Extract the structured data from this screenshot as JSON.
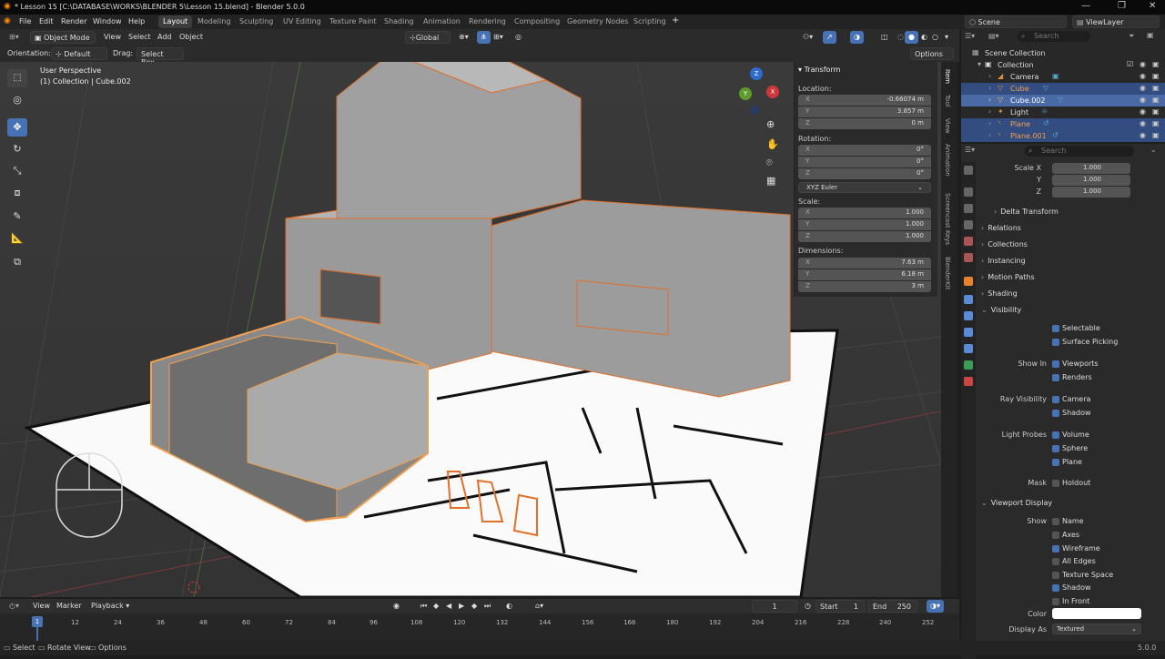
{
  "titlebar": {
    "title": "* Lesson 15 [C:\\DATABASE\\WORKS\\BLENDER 5\\Lesson 15.blend] - Blender 5.0.0"
  },
  "menu": {
    "file": "File",
    "edit": "Edit",
    "render": "Render",
    "window": "Window",
    "help": "Help"
  },
  "workspaces": [
    "Layout",
    "Modeling",
    "Sculpting",
    "UV Editing",
    "Texture Paint",
    "Shading",
    "Animation",
    "Rendering",
    "Compositing",
    "Geometry Nodes",
    "Scripting"
  ],
  "topright": {
    "scene": "Scene",
    "viewlayer": "ViewLayer"
  },
  "vptool": {
    "mode": "Object Mode",
    "view": "View",
    "select": "Select",
    "add": "Add",
    "object": "Object",
    "transform": "Global"
  },
  "vphdr2": {
    "orientation_label": "Orientation:",
    "orientation": "Default",
    "drag_label": "Drag:",
    "drag": "Select Box",
    "options": "Options"
  },
  "viewport": {
    "perspective": "User Perspective",
    "collection": "(1) Collection | Cube.002"
  },
  "npanel": {
    "title": "Transform",
    "location_label": "Location:",
    "loc_x": "-0.66074 m",
    "loc_y": "3.857 m",
    "loc_z": "0 m",
    "rotation_label": "Rotation:",
    "rot_x": "0°",
    "rot_y": "0°",
    "rot_z": "0°",
    "euler": "XYZ Euler",
    "scale_label": "Scale:",
    "scale_x": "1.000",
    "scale_y": "1.000",
    "scale_z": "1.000",
    "dimensions_label": "Dimensions:",
    "dim_x": "7.63 m",
    "dim_y": "6.18 m",
    "dim_z": "3 m",
    "x": "X",
    "y": "Y",
    "z": "Z"
  },
  "ntabs": [
    "Item",
    "Tool",
    "View",
    "Animation",
    "Screencast Keys",
    "BlenderKit"
  ],
  "outliner": {
    "search_placeholder": "Search",
    "scene_collection": "Scene Collection",
    "collection": "Collection",
    "items": [
      "Camera",
      "Cube",
      "Cube.002",
      "Light",
      "Plane",
      "Plane.001"
    ]
  },
  "props": {
    "search_placeholder": "Search",
    "scale_x_label": "Scale X",
    "scale_y_label": "Y",
    "scale_z_label": "Z",
    "scale_x": "1.000",
    "scale_y": "1.000",
    "scale_z": "1.000",
    "delta": "Delta Transform",
    "relations": "Relations",
    "collections": "Collections",
    "instancing": "Instancing",
    "motion_paths": "Motion Paths",
    "shading": "Shading",
    "visibility": "Visibility",
    "selectable": "Selectable",
    "surface_picking": "Surface Picking",
    "show_in": "Show In",
    "viewports": "Viewports",
    "renders": "Renders",
    "ray_visibility": "Ray Visibility",
    "camera": "Camera",
    "shadow": "Shadow",
    "light_probes": "Light Probes",
    "volume": "Volume",
    "sphere": "Sphere",
    "plane": "Plane",
    "mask": "Mask",
    "holdout": "Holdout",
    "viewport_display": "Viewport Display",
    "show": "Show",
    "name": "Name",
    "axes": "Axes",
    "wireframe": "Wireframe",
    "all_edges": "All Edges",
    "texture_space": "Texture Space",
    "shadow2": "Shadow",
    "in_front": "In Front",
    "color": "Color",
    "display_as_label": "Display As",
    "display_as": "Textured"
  },
  "timeline": {
    "view": "View",
    "marker": "Marker",
    "playback": "Playback",
    "current_frame": "1",
    "start_label": "Start",
    "start": "1",
    "end_label": "End",
    "end": "250",
    "ticks": [
      "12",
      "24",
      "36",
      "48",
      "60",
      "72",
      "84",
      "96",
      "108",
      "120",
      "132",
      "144",
      "156",
      "168",
      "180",
      "192",
      "204",
      "216",
      "228",
      "240",
      "252"
    ],
    "cursor": "1"
  },
  "statusbar": {
    "select": "Select",
    "rotate": "Rotate View",
    "options": "Options",
    "version": "5.0.0"
  },
  "colors": {
    "accent": "#4772b3",
    "selected_orange": "#f0a050",
    "bg": "#1d1d1d"
  }
}
